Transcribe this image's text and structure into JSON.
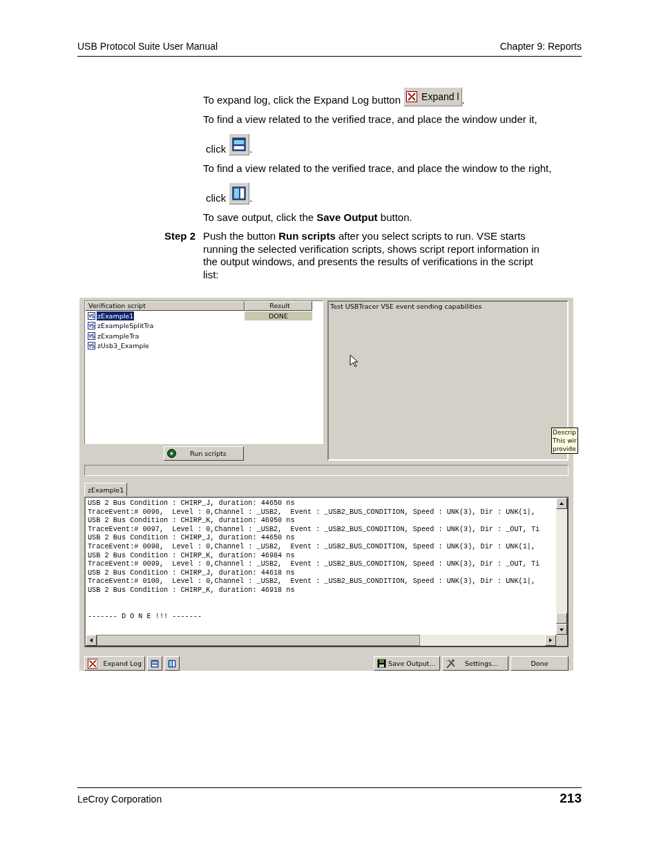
{
  "header": {
    "left": "USB Protocol Suite User Manual",
    "right": "Chapter 9: Reports"
  },
  "instructions": [
    {
      "kind": "button_line",
      "text": "To expand log, click the Expand Log button",
      "button": "Expand l",
      "after": "."
    },
    {
      "kind": "text",
      "text": "To find a view related to the verified trace, and place the window under it,"
    },
    {
      "kind": "icon_line",
      "text": "click",
      "after": "."
    },
    {
      "kind": "text",
      "text": "To find a view related to the verified trace, and place the window to the right,"
    },
    {
      "kind": "icon_line",
      "text": "click",
      "after": "."
    },
    {
      "kind": "text",
      "text": "To save output, click the **Save Output** button."
    }
  ],
  "step": {
    "label": "Step 2",
    "text": "Push the button **Run scripts** after you select scripts to run. VSE starts running the selected verification scripts, shows script report information in the output windows, and presents the results of verifications in the script list:"
  },
  "app": {
    "script_list": {
      "columns": [
        "Verification script",
        "Result"
      ],
      "rows": [
        {
          "name": "zExample1",
          "result": "DONE",
          "selected": true
        },
        {
          "name": "zExampleSplitTra",
          "selected": false
        },
        {
          "name": "zExampleTra",
          "selected": false
        },
        {
          "name": "zUsb3_Example",
          "selected": false
        }
      ]
    },
    "run_button": "Run scripts",
    "description": "Test USBTracer VSE event sending capabilities",
    "tooltip_lines": [
      "Descrip",
      "This wir",
      "provide"
    ],
    "log_tabs": [
      {
        "label": "zExample1",
        "selected": true
      }
    ],
    "log_lines": [
      "USB 2 Bus Condition : CHIRP_J, duration: 44650 ns",
      "TraceEvent:# 0096,  Level : 0,Channel : _USB2,  Event : _USB2_BUS_CONDITION, Speed : UNK(3), Dir : UNK(1|,",
      "USB 2 Bus Condition : CHIRP_K, duration: 46950 ns",
      "TraceEvent:# 0097,  Level : 0,Channel : _USB2,  Event : _USB2_BUS_CONDITION, Speed : UNK(3), Dir : _OUT, Ti",
      "USB 2 Bus Condition : CHIRP_J, duration: 44650 ns",
      "TraceEvent:# 0098,  Level : 0,Channel : _USB2,  Event : _USB2_BUS_CONDITION, Speed : UNK(3), Dir : UNK(1|,",
      "USB 2 Bus Condition : CHIRP_K, duration: 46984 ns",
      "TraceEvent:# 0099,  Level : 0,Channel : _USB2,  Event : _USB2_BUS_CONDITION, Speed : UNK(3), Dir : _OUT, Ti",
      "USB 2 Bus Condition : CHIRP_J, duration: 44618 ns",
      "TraceEvent:# 0100,  Level : 0,Channel : _USB2,  Event : _USB2_BUS_CONDITION, Speed : UNK(3), Dir : UNK(1|,",
      "USB 2 Bus Condition : CHIRP_K, duration: 46918 ns"
    ],
    "log_done": "------- D O N E !!! -------",
    "left_buttons": [
      {
        "kind": "expand",
        "label": "Expand Log"
      },
      {
        "kind": "view_under"
      },
      {
        "kind": "view_right"
      }
    ],
    "right_buttons": [
      {
        "kind": "save",
        "label": "Save Output..."
      },
      {
        "kind": "settings",
        "label": "Settings..."
      },
      {
        "kind": "plain",
        "label": "Done"
      }
    ]
  },
  "footer": {
    "left": "LeCroy Corporation",
    "page": "213"
  }
}
